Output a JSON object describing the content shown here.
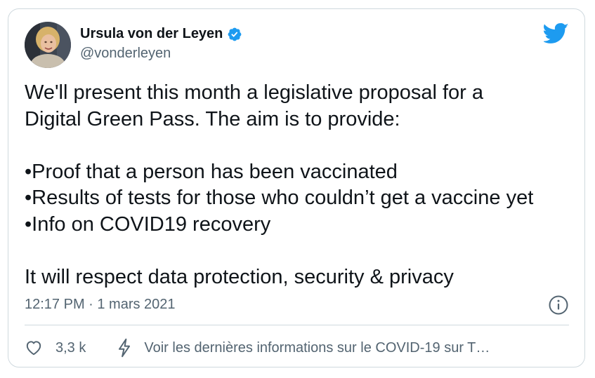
{
  "tweet": {
    "author_name": "Ursula von der Leyen",
    "author_handle": "@vonderleyen",
    "verified": true,
    "text_lines": [
      "We'll present this month a legislative proposal for a",
      "Digital Green Pass. The aim is to provide:",
      "",
      "•Proof that a person has been vaccinated",
      "•Results of tests for those who couldn’t get a vaccine yet",
      "•Info on COVID19 recovery",
      "",
      "It will respect data protection, security & privacy"
    ],
    "timestamp": "12:17 PM · 1 mars 2021",
    "like_count": "3,3 k",
    "topic_link": "Voir les dernières informations sur le COVID-19 sur T…"
  },
  "icons": {
    "verified": "verified-badge-icon",
    "brand": "twitter-bird-icon",
    "info": "info-icon",
    "like": "heart-icon",
    "topic": "lightning-bolt-icon"
  },
  "colors": {
    "brand_blue": "#1d9bf0",
    "text_primary": "#0f1419",
    "text_secondary": "#536471",
    "border": "#cfd9de"
  }
}
